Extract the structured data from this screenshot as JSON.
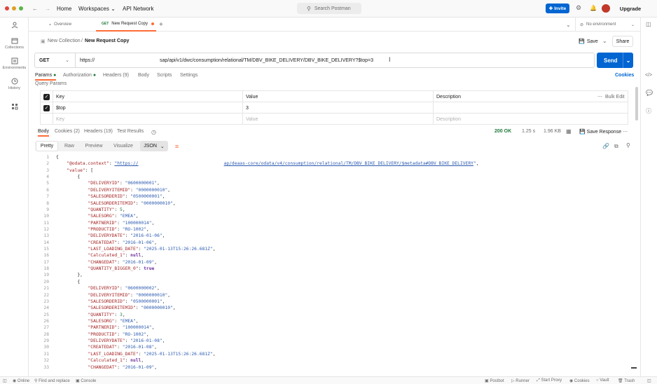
{
  "topbar": {
    "home": "Home",
    "workspaces": "Workspaces",
    "api_network": "API Network",
    "search_placeholder": "Search Postman",
    "invite": "Invite",
    "upgrade": "Upgrade"
  },
  "sidebar": {
    "items": [
      {
        "label": "Collections",
        "icon": "collections-icon"
      },
      {
        "label": "Environments",
        "icon": "environments-icon"
      },
      {
        "label": "History",
        "icon": "history-icon"
      }
    ]
  },
  "tabs": {
    "overview": "Overview",
    "active_method": "GET",
    "active_label": "New Request Copy",
    "environment": "No environment"
  },
  "breadcrumb": {
    "parent": "New Collection",
    "sep": "/",
    "current": "New Request Copy",
    "save": "Save",
    "share": "Share"
  },
  "request": {
    "method": "GET",
    "url_prefix": "https://",
    "url_suffix": "sap/api/v1/dwc/consumption/relational/TM/DBV_BIKE_DELIVERY/DBV_BIKE_DELIVERY?$top=3",
    "send": "Send"
  },
  "req_tabs": {
    "params": "Params",
    "authorization": "Authorization",
    "headers": "Headers (9)",
    "body": "Body",
    "scripts": "Scripts",
    "settings": "Settings",
    "cookies": "Cookies",
    "query_params": "Query Params"
  },
  "params_table": {
    "headers": [
      "Key",
      "Value",
      "Description"
    ],
    "bulk_edit": "Bulk Edit",
    "rows": [
      {
        "key": "$top",
        "value": "3",
        "description": ""
      }
    ],
    "placeholder": {
      "key": "Key",
      "value": "Value",
      "description": "Description"
    }
  },
  "response": {
    "tabs": [
      "Body",
      "Cookies (2)",
      "Headers (19)",
      "Test Results"
    ],
    "status": "200 OK",
    "time": "1.25 s",
    "size": "1.96 KB",
    "save_response": "Save Response",
    "view_modes": [
      "Pretty",
      "Raw",
      "Preview",
      "Visualize"
    ],
    "format": "JSON"
  },
  "code_lines": [
    "{",
    "    \"@odata.context\": \"https://",
    "    \"value\": [",
    "        {",
    "            \"DELIVERYID\": \"0600000001\",",
    "            \"DELIVERYITEMID\": \"0000000010\",",
    "            \"SALESORDERID\": \"0500000001\",",
    "            \"SALESORDERITEMID\": \"0000000010\",",
    "            \"QUANTITY\": 5,",
    "            \"SALESORG\": \"EMEA\",",
    "            \"PARTNERID\": \"100000014\",",
    "            \"PRODUCTID\": \"RO-1002\",",
    "            \"DELIVERYDATE\": \"2016-01-06\",",
    "            \"CREATEDAT\": \"2016-01-06\",",
    "            \"LAST_LOADING_DATE\": \"2025-01-13T15:26:26.681Z\",",
    "            \"Calculated_1\": null,",
    "            \"CHANGEDAT\": \"2016-01-09\",",
    "            \"QUANTITY_BIGGER_0\": true",
    "        },",
    "        {",
    "            \"DELIVERYID\": \"0600000002\",",
    "            \"DELIVERYITEMID\": \"0000000010\",",
    "            \"SALESORDERID\": \"0500000001\",",
    "            \"SALESORDERITEMID\": \"0000000010\",",
    "            \"QUANTITY\": 3,",
    "            \"SALESORG\": \"EMEA\",",
    "            \"PARTNERID\": \"100000014\",",
    "            \"PRODUCTID\": \"RO-1002\",",
    "            \"DELIVERYDATE\": \"2016-01-08\",",
    "            \"CREATEDAT\": \"2016-01-08\",",
    "            \"LAST_LOADING_DATE\": \"2025-01-13T15:26:26.681Z\",",
    "            \"Calculated_1\": null,",
    "            \"CHANGEDAT\": \"2016-01-09\","
  ],
  "odata_link_tail": "ap/deaas-core/odata/v4/consumption/relational/TM/DBV_BIKE_DELIVERY/$metadata#DBV_BIKE_DELIVERY",
  "statusbar": {
    "online": "Online",
    "find_replace": "Find and replace",
    "console": "Console",
    "postbot": "Postbot",
    "runner": "Runner",
    "start_proxy": "Start Proxy",
    "cookies": "Cookies",
    "vault": "Vault",
    "trash": "Trash"
  },
  "colors": {
    "accent": "#0265d2",
    "brand": "#ff6c37",
    "status_ok": "#1f7a3a"
  }
}
